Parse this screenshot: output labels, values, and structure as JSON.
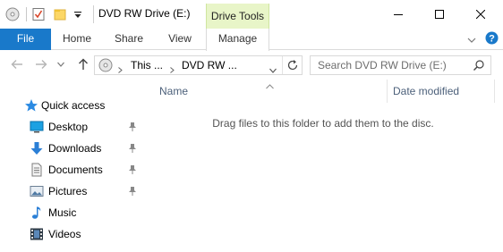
{
  "window": {
    "title": "DVD RW Drive (E:)",
    "context_tab_group": "Drive Tools"
  },
  "ribbon": {
    "tabs": [
      {
        "label": "File"
      },
      {
        "label": "Home"
      },
      {
        "label": "Share"
      },
      {
        "label": "View"
      },
      {
        "label": "Manage"
      }
    ]
  },
  "address_bar": {
    "segments": [
      "This ...",
      "DVD RW ..."
    ],
    "search_placeholder": "Search DVD RW Drive (E:)"
  },
  "nav_pane": {
    "quick_access_label": "Quick access",
    "items": [
      {
        "label": "Desktop",
        "icon": "desktop-icon",
        "pinned": true
      },
      {
        "label": "Downloads",
        "icon": "downloads-icon",
        "pinned": true
      },
      {
        "label": "Documents",
        "icon": "documents-icon",
        "pinned": true
      },
      {
        "label": "Pictures",
        "icon": "pictures-icon",
        "pinned": true
      },
      {
        "label": "Music",
        "icon": "music-icon",
        "pinned": false
      },
      {
        "label": "Videos",
        "icon": "videos-icon",
        "pinned": false
      }
    ]
  },
  "content": {
    "columns": [
      {
        "label": "Name"
      },
      {
        "label": "Date modified"
      }
    ],
    "empty_message": "Drag files to this folder to add them to the disc."
  },
  "colors": {
    "file_tab": "#1979ca",
    "context_tab": "#e8f5c8",
    "column_header_text": "#4c607a",
    "help_icon": "#1979ca"
  }
}
